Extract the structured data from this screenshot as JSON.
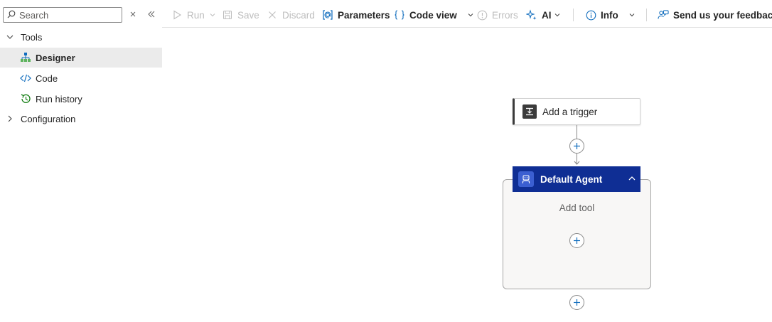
{
  "sidebar": {
    "search": {
      "placeholder": "Search"
    },
    "tree": [
      {
        "label": "Tools",
        "expanded": true
      },
      {
        "label": "Designer",
        "selected": true,
        "icon": "designer-icon"
      },
      {
        "label": "Code",
        "icon": "code-icon"
      },
      {
        "label": "Run history",
        "icon": "run-history-icon"
      },
      {
        "label": "Configuration",
        "expanded": false
      }
    ]
  },
  "toolbar": {
    "run": "Run",
    "save": "Save",
    "discard": "Discard",
    "parameters": "Parameters",
    "code_view": "Code view",
    "errors": "Errors",
    "ai": "AI",
    "info": "Info",
    "feedback": "Send us your feedback"
  },
  "canvas": {
    "trigger_label": "Add a trigger",
    "agent_title": "Default Agent",
    "add_tool_label": "Add tool"
  },
  "colors": {
    "agent_header": "#0f2e94",
    "accent_blue": "#0f6cbd",
    "selected_row": "#ebebeb"
  }
}
